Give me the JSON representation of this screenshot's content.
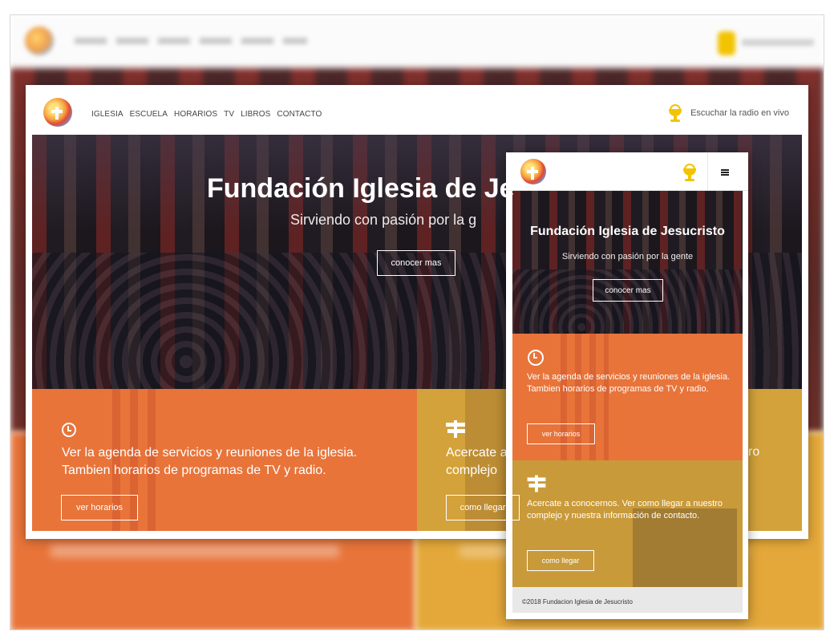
{
  "desktop": {
    "nav": {
      "links": [
        "IGLESIA",
        "ESCUELA",
        "HORARIOS",
        "TV",
        "LIBROS",
        "CONTACTO"
      ],
      "radio_label": "Escuchar la radio en vivo",
      "radio_icon": "radio-cup-icon",
      "logo_icon": "church-logo-icon"
    },
    "hero": {
      "title": "Fundación Iglesia de Je",
      "subtitle": "Sirviendo con pasión por la g",
      "button": "conocer mas"
    },
    "features": [
      {
        "icon": "clock-icon",
        "text": "Ver la agenda de servicios y reuniones de la iglesia. Tambien horarios de programas de TV y radio.",
        "button": "ver horarios",
        "color": "#e8743a"
      },
      {
        "icon": "signpost-icon",
        "text": "Acercate a\ncomplejo",
        "trailing": "ro",
        "button": "como llegar",
        "color": "#d4a23a"
      }
    ]
  },
  "mobile": {
    "nav": {
      "logo_icon": "church-logo-icon",
      "radio_icon": "radio-cup-icon",
      "menu_icon": "hamburger-menu-icon"
    },
    "hero": {
      "title": "Fundación Iglesia de Jesucristo",
      "subtitle": "Sirviendo con pasión por la gente",
      "button": "conocer mas"
    },
    "features": [
      {
        "icon": "clock-icon",
        "text": "Ver la agenda de servicios y reuniones de la iglesia. Tambien horarios de programas de TV y radio.",
        "button": "ver horarios"
      },
      {
        "icon": "signpost-icon",
        "text": "Acercate a conocernos. Ver como llegar a nuestro complejo y nuestra información de contacto.",
        "button": "como llegar"
      }
    ],
    "footer": "©2018 Fundacion Iglesia de Jesucristo"
  }
}
